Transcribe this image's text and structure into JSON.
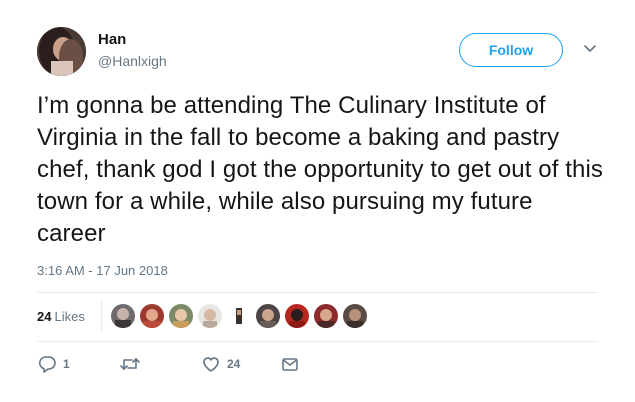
{
  "user": {
    "display_name": "Han",
    "handle": "@Hanlxigh"
  },
  "follow_button": {
    "label": "Follow"
  },
  "tweet": {
    "text": "I’m gonna be attending The Culinary Institute of Virginia in the fall to become a baking and pastry chef, thank god I got the opportunity to get out of this town for a while, while also pursuing my future career",
    "timestamp": "3:16 AM - 17 Jun 2018"
  },
  "stats": {
    "likes_count": "24",
    "likes_label": "Likes"
  },
  "actions": {
    "reply_count": "1",
    "retweet_count": "",
    "like_count": "24"
  },
  "colors": {
    "accent": "#1da1f2",
    "secondary_text": "#657786",
    "divider": "#e6ecf0"
  },
  "icons": [
    "chevron-down-icon",
    "reply-icon",
    "retweet-icon",
    "heart-icon",
    "envelope-icon"
  ]
}
